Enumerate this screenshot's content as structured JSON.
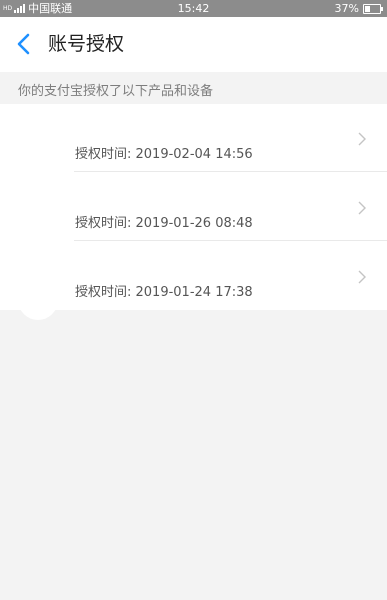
{
  "status_bar": {
    "hd_label": "HD",
    "carrier": "中国联通",
    "time": "15:42",
    "battery": "37%"
  },
  "nav": {
    "title": "账号授权",
    "back_icon": "chevron-left-icon"
  },
  "section": {
    "subtitle": "你的支付宝授权了以下产品和设备"
  },
  "authorizations": [
    {
      "label": "授权时间: 2019-02-04 14:56"
    },
    {
      "label": "授权时间: 2019-01-26 08:48"
    },
    {
      "label": "授权时间: 2019-01-24 17:38"
    }
  ],
  "colors": {
    "accent": "#1e90ff",
    "status_bar": "#8c8c8c",
    "background": "#f3f3f3"
  }
}
